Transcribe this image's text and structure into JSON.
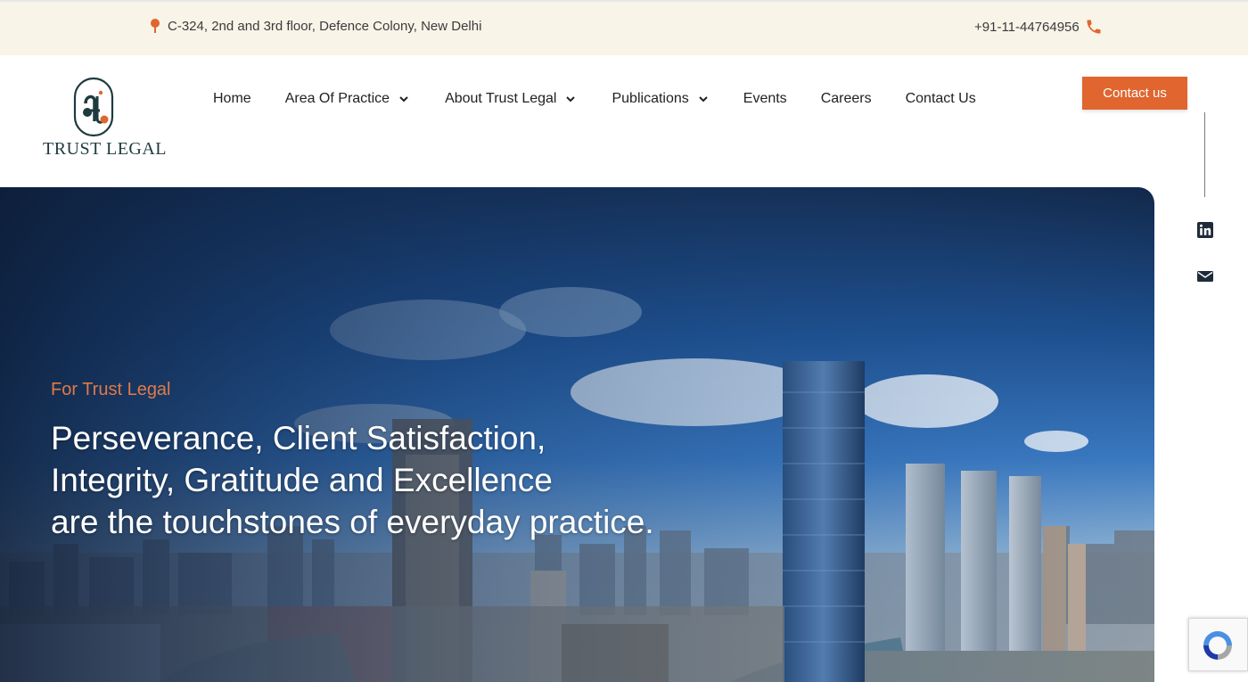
{
  "topbar": {
    "address": "C-324, 2nd and 3rd floor, Defence Colony, New Delhi",
    "phone": "+91-11-44764956",
    "accent_color": "#e0652f",
    "background": "#f8f4e8"
  },
  "logo": {
    "wordmark": "TRUST LEGAL"
  },
  "nav": {
    "items": [
      {
        "label": "Home",
        "has_dropdown": false
      },
      {
        "label": "Area Of Practice",
        "has_dropdown": true
      },
      {
        "label": "About Trust Legal",
        "has_dropdown": true
      },
      {
        "label": "Publications",
        "has_dropdown": true
      },
      {
        "label": "Events",
        "has_dropdown": false
      },
      {
        "label": "Careers",
        "has_dropdown": false
      },
      {
        "label": "Contact Us",
        "has_dropdown": false
      }
    ]
  },
  "cta": {
    "label": "Contact us",
    "color": "#e0652f"
  },
  "social": {
    "icons": [
      "linkedin-icon",
      "mail-icon"
    ]
  },
  "hero": {
    "kicker": "For Trust Legal",
    "headline_lines": [
      "Perseverance, Client Satisfaction,",
      "Integrity, Gratitude and Excellence",
      "are the touchstones of everyday practice."
    ],
    "kicker_color": "#e07a47"
  }
}
